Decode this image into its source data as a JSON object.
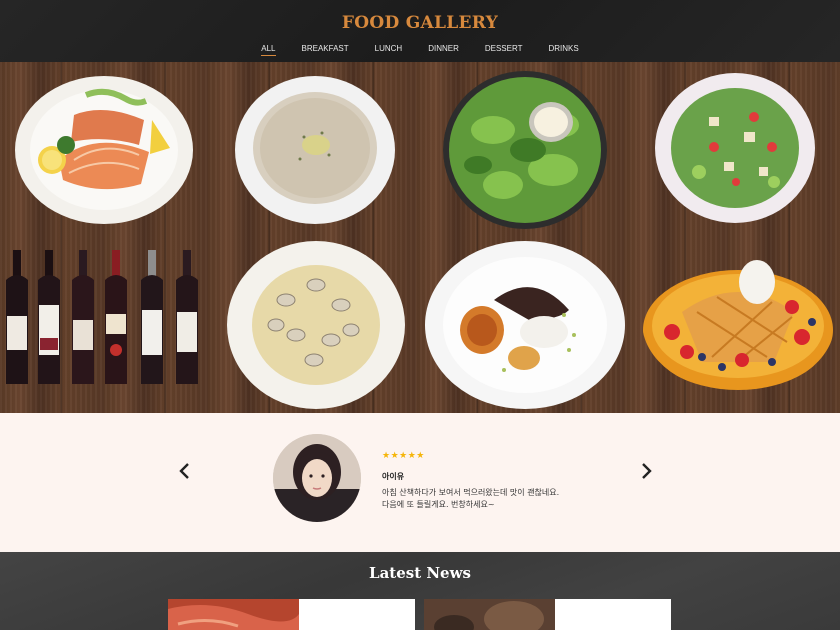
{
  "header": {
    "brand": "FOOD GALLERY",
    "nav": [
      "ALL",
      "BREAKFAST",
      "LUNCH",
      "DINNER",
      "DESSERT",
      "DRINKS"
    ],
    "active_nav": "ALL"
  },
  "gallery": {
    "items": [
      "salmon-plate",
      "cream-soup",
      "green-salad",
      "chopped-salad",
      "wine-bottles",
      "clam-pasta",
      "dessert-plate",
      "berry-waffle"
    ]
  },
  "testimonial": {
    "stars": "★★★★★",
    "name": "아이유",
    "text_line1": "아침 산책하다가 보여서 먹으러왔는데 맛이 괜찮네요.",
    "text_line2": "다음에 또 들릴게요. 번창하세요~",
    "prev_icon": "chevron-left-icon",
    "next_icon": "chevron-right-icon"
  },
  "news": {
    "title": "Latest News"
  },
  "colors": {
    "accent": "#d7893d",
    "header_bg": "#212121",
    "testimonial_bg": "#fdf4f0",
    "star": "#f5b50a"
  }
}
